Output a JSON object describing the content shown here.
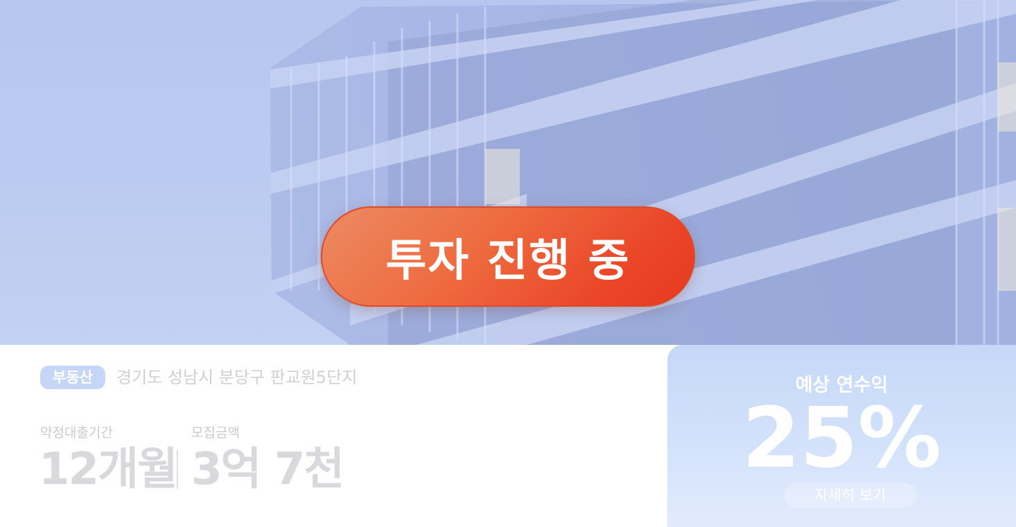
{
  "hero": {
    "status_button_label": "투자 진행 중"
  },
  "listing": {
    "category_badge": "부동산",
    "address": "경기도 성남시 분당구 판교원5단지",
    "loan_period_label": "약정대출기간",
    "loan_period_value": "12개월",
    "raise_amount_label": "모집금액",
    "raise_amount_value": "3억 7천"
  },
  "yield_card": {
    "title": "예상 연수익",
    "value": "25%",
    "detail_button_label": "자세히 보기"
  },
  "colors": {
    "cta_start": "#ec8a63",
    "cta_end": "#e63a1f",
    "badge_bg": "#c6d6f7",
    "card_bg": "#c5d8f8"
  }
}
